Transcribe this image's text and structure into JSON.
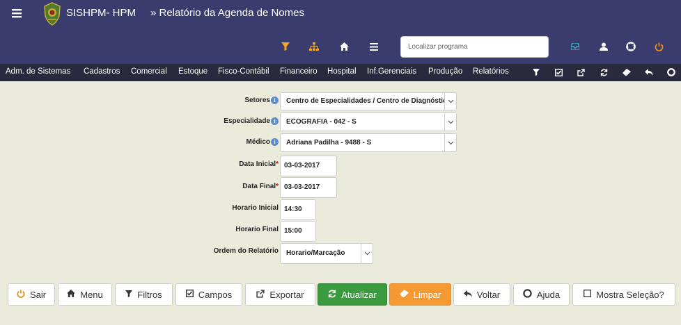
{
  "app": {
    "brand": "SISHPM- HPM",
    "page_title": "» Relatório da Agenda de Nomes",
    "search_placeholder": "Localizar programa"
  },
  "menu": {
    "items": [
      "Adm. de Sistemas",
      "Cadastros",
      "Comercial",
      "Estoque",
      "Fisco-Contábil",
      "Financeiro",
      "Hospital",
      "Inf.Gerenciais",
      "Produção",
      "Relatórios"
    ]
  },
  "form": {
    "setores_label": "Setores",
    "setores_value": "Centro de Especialidades / Centro de Diagnóstico",
    "especialidade_label": "Especialidade",
    "especialidade_value": "ECOGRAFIA - 042 - S",
    "medico_label": "Médico",
    "medico_value": "Adriana Padilha - 9488 - S",
    "data_inicial_label": "Data Inicial",
    "data_inicial_value": "03-03-2017",
    "data_final_label": "Data Final",
    "data_final_value": "03-03-2017",
    "horario_inicial_label": "Horario Inicial",
    "horario_inicial_value": "14:30",
    "horario_final_label": "Horario Final",
    "horario_final_value": "15:00",
    "ordem_label": "Ordem do Relatório",
    "ordem_value": "Horario/Marcação",
    "required_mark": "*",
    "info_mark": "i"
  },
  "buttons": {
    "sair": "Sair",
    "menu": "Menu",
    "filtros": "Filtros",
    "campos": "Campos",
    "exportar": "Exportar",
    "atualizar": "Atualizar",
    "limpar": "Limpar",
    "voltar": "Voltar",
    "ajuda": "Ajuda",
    "mostra_selecao": "Mostra Seleção?"
  },
  "colors": {
    "header_bg": "#3b3c6e",
    "menubar_bg": "#2a2a3e",
    "page_bg": "#ebebdc",
    "accent_orange": "#f5a623",
    "atualizar_bg": "#3a9b3e",
    "limpar_bg": "#f59a33"
  },
  "icons": {
    "toolbar": [
      "filter-icon",
      "sitemap-icon",
      "home-icon",
      "list-icon",
      "inbox-icon",
      "user-icon",
      "lifebuoy-icon",
      "power-icon"
    ],
    "menubar": [
      "filter-icon",
      "check-square-icon",
      "external-link-icon",
      "refresh-icon",
      "eraser-icon",
      "reply-icon",
      "lifebuoy-icon"
    ]
  }
}
